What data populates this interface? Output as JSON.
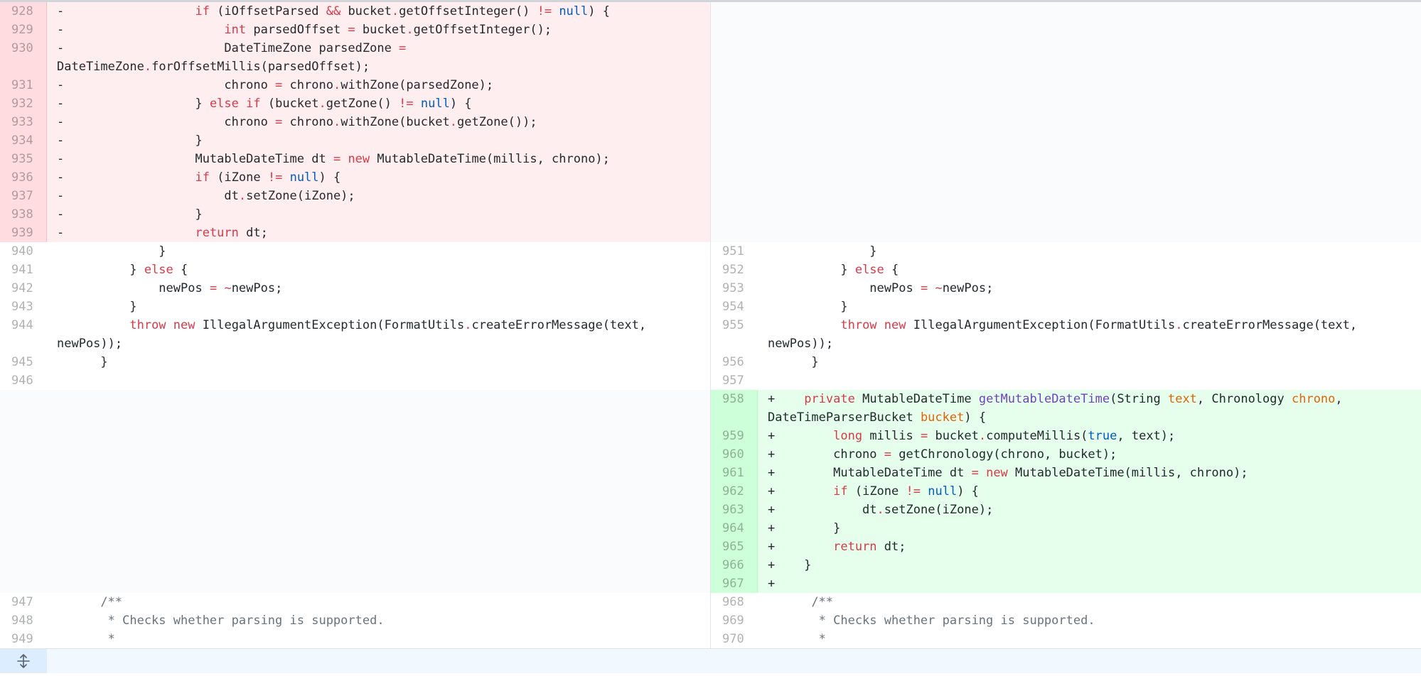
{
  "diff": {
    "rows": [
      {
        "l": {
          "t": "del",
          "n": "928",
          "c": [
            [
              "-                  ",
              ""
            ],
            [
              "if",
              "kw"
            ],
            [
              " (iOffsetParsed ",
              ""
            ],
            [
              "&&",
              "kw"
            ],
            [
              " bucket",
              ""
            ],
            [
              ".",
              "kw"
            ],
            [
              "getOffsetInteger() ",
              ""
            ],
            [
              "!=",
              "kw"
            ],
            [
              " ",
              ""
            ],
            [
              "null",
              "const"
            ],
            [
              ") {",
              ""
            ]
          ]
        },
        "r": {
          "t": "empty"
        }
      },
      {
        "l": {
          "t": "del",
          "n": "929",
          "c": [
            [
              "-                      ",
              ""
            ],
            [
              "int",
              "kw"
            ],
            [
              " parsedOffset ",
              ""
            ],
            [
              "=",
              "kw"
            ],
            [
              " bucket",
              ""
            ],
            [
              ".",
              "kw"
            ],
            [
              "getOffsetInteger();",
              ""
            ]
          ]
        },
        "r": {
          "t": "empty"
        }
      },
      {
        "l": {
          "t": "del",
          "n": "930",
          "c": [
            [
              "-                      DateTimeZone parsedZone ",
              ""
            ],
            [
              "=",
              "kw"
            ]
          ]
        },
        "r": {
          "t": "empty"
        }
      },
      {
        "l": {
          "t": "del",
          "n": "",
          "c": [
            [
              "DateTimeZone",
              ""
            ],
            [
              ".",
              "kw"
            ],
            [
              "forOffsetMillis(parsedOffset);",
              ""
            ]
          ]
        },
        "r": {
          "t": "empty"
        }
      },
      {
        "l": {
          "t": "del",
          "n": "931",
          "c": [
            [
              "-                      chrono ",
              ""
            ],
            [
              "=",
              "kw"
            ],
            [
              " chrono",
              ""
            ],
            [
              ".",
              "kw"
            ],
            [
              "withZone(parsedZone);",
              ""
            ]
          ]
        },
        "r": {
          "t": "empty"
        }
      },
      {
        "l": {
          "t": "del",
          "n": "932",
          "c": [
            [
              "-                  } ",
              ""
            ],
            [
              "else",
              "kw"
            ],
            [
              " ",
              ""
            ],
            [
              "if",
              "kw"
            ],
            [
              " (bucket",
              ""
            ],
            [
              ".",
              "kw"
            ],
            [
              "getZone() ",
              ""
            ],
            [
              "!=",
              "kw"
            ],
            [
              " ",
              ""
            ],
            [
              "null",
              "const"
            ],
            [
              ") {",
              ""
            ]
          ]
        },
        "r": {
          "t": "empty"
        }
      },
      {
        "l": {
          "t": "del",
          "n": "933",
          "c": [
            [
              "-                      chrono ",
              ""
            ],
            [
              "=",
              "kw"
            ],
            [
              " chrono",
              ""
            ],
            [
              ".",
              "kw"
            ],
            [
              "withZone(bucket",
              ""
            ],
            [
              ".",
              "kw"
            ],
            [
              "getZone());",
              ""
            ]
          ]
        },
        "r": {
          "t": "empty"
        }
      },
      {
        "l": {
          "t": "del",
          "n": "934",
          "c": [
            [
              "-                  }",
              ""
            ]
          ]
        },
        "r": {
          "t": "empty"
        }
      },
      {
        "l": {
          "t": "del",
          "n": "935",
          "c": [
            [
              "-                  MutableDateTime dt ",
              ""
            ],
            [
              "=",
              "kw"
            ],
            [
              " ",
              ""
            ],
            [
              "new",
              "kw"
            ],
            [
              " MutableDateTime(millis, chrono);",
              ""
            ]
          ]
        },
        "r": {
          "t": "empty"
        }
      },
      {
        "l": {
          "t": "del",
          "n": "936",
          "c": [
            [
              "-                  ",
              ""
            ],
            [
              "if",
              "kw"
            ],
            [
              " (iZone ",
              ""
            ],
            [
              "!=",
              "kw"
            ],
            [
              " ",
              ""
            ],
            [
              "null",
              "const"
            ],
            [
              ") {",
              ""
            ]
          ]
        },
        "r": {
          "t": "empty"
        }
      },
      {
        "l": {
          "t": "del",
          "n": "937",
          "c": [
            [
              "-                      dt",
              ""
            ],
            [
              ".",
              "kw"
            ],
            [
              "setZone(iZone);",
              ""
            ]
          ]
        },
        "r": {
          "t": "empty"
        }
      },
      {
        "l": {
          "t": "del",
          "n": "938",
          "c": [
            [
              "-                  }",
              ""
            ]
          ]
        },
        "r": {
          "t": "empty"
        }
      },
      {
        "l": {
          "t": "del",
          "n": "939",
          "c": [
            [
              "-                  ",
              ""
            ],
            [
              "return",
              "kw"
            ],
            [
              " dt;",
              ""
            ]
          ]
        },
        "r": {
          "t": "empty"
        }
      },
      {
        "l": {
          "t": "ctx",
          "n": "940",
          "c": [
            [
              "              }",
              ""
            ]
          ]
        },
        "r": {
          "t": "ctx",
          "n": "951",
          "c": [
            [
              "              }",
              ""
            ]
          ]
        }
      },
      {
        "l": {
          "t": "ctx",
          "n": "941",
          "c": [
            [
              "          } ",
              ""
            ],
            [
              "else",
              "kw"
            ],
            [
              " {",
              ""
            ]
          ]
        },
        "r": {
          "t": "ctx",
          "n": "952",
          "c": [
            [
              "          } ",
              ""
            ],
            [
              "else",
              "kw"
            ],
            [
              " {",
              ""
            ]
          ]
        }
      },
      {
        "l": {
          "t": "ctx",
          "n": "942",
          "c": [
            [
              "              newPos ",
              ""
            ],
            [
              "=",
              "kw"
            ],
            [
              " ",
              ""
            ],
            [
              "~",
              "kw"
            ],
            [
              "newPos;",
              ""
            ]
          ]
        },
        "r": {
          "t": "ctx",
          "n": "953",
          "c": [
            [
              "              newPos ",
              ""
            ],
            [
              "=",
              "kw"
            ],
            [
              " ",
              ""
            ],
            [
              "~",
              "kw"
            ],
            [
              "newPos;",
              ""
            ]
          ]
        }
      },
      {
        "l": {
          "t": "ctx",
          "n": "943",
          "c": [
            [
              "          }",
              ""
            ]
          ]
        },
        "r": {
          "t": "ctx",
          "n": "954",
          "c": [
            [
              "          }",
              ""
            ]
          ]
        }
      },
      {
        "l": {
          "t": "ctx",
          "n": "944",
          "c": [
            [
              "          ",
              ""
            ],
            [
              "throw",
              "kw"
            ],
            [
              " ",
              ""
            ],
            [
              "new",
              "kw"
            ],
            [
              " IllegalArgumentException(FormatUtils",
              ""
            ],
            [
              ".",
              "kw"
            ],
            [
              "createErrorMessage(text,",
              ""
            ]
          ]
        },
        "r": {
          "t": "ctx",
          "n": "955",
          "c": [
            [
              "          ",
              ""
            ],
            [
              "throw",
              "kw"
            ],
            [
              " ",
              ""
            ],
            [
              "new",
              "kw"
            ],
            [
              " IllegalArgumentException(FormatUtils",
              ""
            ],
            [
              ".",
              "kw"
            ],
            [
              "createErrorMessage(text,",
              ""
            ]
          ]
        }
      },
      {
        "l": {
          "t": "ctx",
          "n": "",
          "c": [
            [
              "newPos));",
              ""
            ]
          ]
        },
        "r": {
          "t": "ctx",
          "n": "",
          "c": [
            [
              "newPos));",
              ""
            ]
          ]
        }
      },
      {
        "l": {
          "t": "ctx",
          "n": "945",
          "c": [
            [
              "      }",
              ""
            ]
          ]
        },
        "r": {
          "t": "ctx",
          "n": "956",
          "c": [
            [
              "      }",
              ""
            ]
          ]
        }
      },
      {
        "l": {
          "t": "ctx",
          "n": "946",
          "c": []
        },
        "r": {
          "t": "ctx",
          "n": "957",
          "c": []
        }
      },
      {
        "l": {
          "t": "empty"
        },
        "r": {
          "t": "add",
          "n": "958",
          "c": [
            [
              "+    ",
              ""
            ],
            [
              "private",
              "kw"
            ],
            [
              " MutableDateTime ",
              ""
            ],
            [
              "getMutableDateTime",
              "fn"
            ],
            [
              "(String ",
              ""
            ],
            [
              "text",
              "var"
            ],
            [
              ", Chronology ",
              ""
            ],
            [
              "chrono",
              "var"
            ],
            [
              ",",
              ""
            ]
          ]
        }
      },
      {
        "l": {
          "t": "empty"
        },
        "r": {
          "t": "add",
          "n": "",
          "c": [
            [
              "DateTimeParserBucket ",
              ""
            ],
            [
              "bucket",
              "var"
            ],
            [
              ") {",
              ""
            ]
          ]
        }
      },
      {
        "l": {
          "t": "empty"
        },
        "r": {
          "t": "add",
          "n": "959",
          "c": [
            [
              "+        ",
              ""
            ],
            [
              "long",
              "kw"
            ],
            [
              " millis ",
              ""
            ],
            [
              "=",
              "kw"
            ],
            [
              " bucket",
              ""
            ],
            [
              ".",
              "kw"
            ],
            [
              "computeMillis(",
              ""
            ],
            [
              "true",
              "const"
            ],
            [
              ", text);",
              ""
            ]
          ]
        }
      },
      {
        "l": {
          "t": "empty"
        },
        "r": {
          "t": "add",
          "n": "960",
          "c": [
            [
              "+        chrono ",
              ""
            ],
            [
              "=",
              "kw"
            ],
            [
              " getChronology(chrono, bucket);",
              ""
            ]
          ]
        }
      },
      {
        "l": {
          "t": "empty"
        },
        "r": {
          "t": "add",
          "n": "961",
          "c": [
            [
              "+        MutableDateTime dt ",
              ""
            ],
            [
              "=",
              "kw"
            ],
            [
              " ",
              ""
            ],
            [
              "new",
              "kw"
            ],
            [
              " MutableDateTime(millis, chrono);",
              ""
            ]
          ]
        }
      },
      {
        "l": {
          "t": "empty"
        },
        "r": {
          "t": "add",
          "n": "962",
          "c": [
            [
              "+        ",
              ""
            ],
            [
              "if",
              "kw"
            ],
            [
              " (iZone ",
              ""
            ],
            [
              "!=",
              "kw"
            ],
            [
              " ",
              ""
            ],
            [
              "null",
              "const"
            ],
            [
              ") {",
              ""
            ]
          ]
        }
      },
      {
        "l": {
          "t": "empty"
        },
        "r": {
          "t": "add",
          "n": "963",
          "c": [
            [
              "+            dt",
              ""
            ],
            [
              ".",
              "kw"
            ],
            [
              "setZone(iZone);",
              ""
            ]
          ]
        }
      },
      {
        "l": {
          "t": "empty"
        },
        "r": {
          "t": "add",
          "n": "964",
          "c": [
            [
              "+        }",
              ""
            ]
          ]
        }
      },
      {
        "l": {
          "t": "empty"
        },
        "r": {
          "t": "add",
          "n": "965",
          "c": [
            [
              "+        ",
              ""
            ],
            [
              "return",
              "kw"
            ],
            [
              " dt;",
              ""
            ]
          ]
        }
      },
      {
        "l": {
          "t": "empty"
        },
        "r": {
          "t": "add",
          "n": "966",
          "c": [
            [
              "+    }",
              ""
            ]
          ]
        }
      },
      {
        "l": {
          "t": "empty"
        },
        "r": {
          "t": "add",
          "n": "967",
          "c": [
            [
              "+",
              ""
            ]
          ]
        }
      },
      {
        "l": {
          "t": "ctx",
          "n": "947",
          "c": [
            [
              "      /**",
              "cmt"
            ]
          ]
        },
        "r": {
          "t": "ctx",
          "n": "968",
          "c": [
            [
              "      /**",
              "cmt"
            ]
          ]
        }
      },
      {
        "l": {
          "t": "ctx",
          "n": "948",
          "c": [
            [
              "       * Checks whether parsing is supported.",
              "cmt"
            ]
          ]
        },
        "r": {
          "t": "ctx",
          "n": "969",
          "c": [
            [
              "       * Checks whether parsing is supported.",
              "cmt"
            ]
          ]
        }
      },
      {
        "l": {
          "t": "ctx",
          "n": "949",
          "c": [
            [
              "       *",
              "cmt"
            ]
          ]
        },
        "r": {
          "t": "ctx",
          "n": "970",
          "c": [
            [
              "       *",
              "cmt"
            ]
          ]
        }
      }
    ],
    "expand_icon": "unfold-icon"
  }
}
